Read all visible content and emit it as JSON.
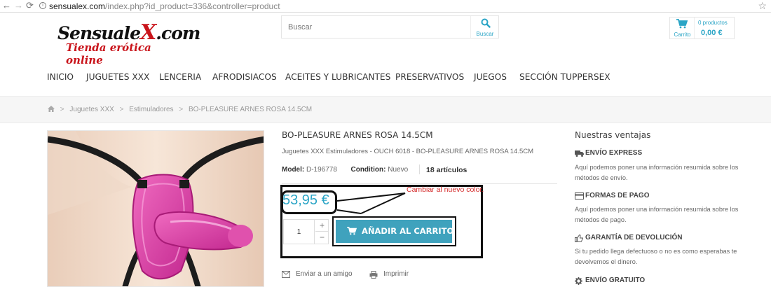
{
  "browser": {
    "url_host": "sensualex.com",
    "url_path": "/index.php?id_product=336&controller=product"
  },
  "header": {
    "logo_main": "Sensuale",
    "logo_x": "X",
    "logo_suffix": ".com",
    "logo_sub": "Tienda erótica online",
    "search_placeholder": "Buscar",
    "search_button": "Buscar",
    "cart_label": "Carrito",
    "cart_count": "0 productos",
    "cart_total": "0,00 €"
  },
  "menu": [
    "INICIO",
    "JUGUETES XXX",
    "LENCERIA",
    "AFRODISIACOS",
    "ACEITES Y LUBRICANTES",
    "PRESERVATIVOS",
    "JUEGOS",
    "SECCIÓN TUPPERSEX"
  ],
  "breadcrumb": {
    "sep": ">",
    "items": [
      "Juguetes XXX",
      "Estimuladores",
      "BO-PLEASURE ARNES ROSA 14.5CM"
    ]
  },
  "product": {
    "title": "BO-PLEASURE ARNES ROSA 14.5CM",
    "categories": "Juguetes XXX Estimuladores - OUCH 6018 - BO-PLEASURE ARNES ROSA 14.5CM",
    "model_label": "Model:",
    "model_value": "D-196778",
    "condition_label": "Condition:",
    "condition_value": "Nuevo",
    "stock": "18 artículos",
    "price": "53,95 €",
    "quantity": "1",
    "qty_up": "+",
    "qty_down": "−",
    "add_to_cart": "AÑADIR AL CARRITO",
    "send_friend": "Enviar a un amigo",
    "print": "Imprimir"
  },
  "annotation": {
    "text": "Cambiar al nuevo color.",
    "color": "#d42a2a"
  },
  "advantages": {
    "title": "Nuestras ventajas",
    "items": [
      {
        "icon": "truck-icon",
        "title": "ENVÍO EXPRESS",
        "text": "Aquí podemos poner una información resumida sobre los métodos de envío."
      },
      {
        "icon": "credit-card-icon",
        "title": "FORMAS DE PAGO",
        "text": "Aquí podemos poner una información resumida sobre los métodos de pago."
      },
      {
        "icon": "thumbs-up-icon",
        "title": "GARANTÍA DE DEVOLUCIÓN",
        "text": "Si tu pedido llega defectuoso o no es como esperabas te devolvemos el dinero."
      },
      {
        "icon": "gear-icon",
        "title": "ENVÍO GRATUITO"
      }
    ]
  },
  "colors": {
    "accent": "#2ba5c6",
    "button": "#3fa2bd",
    "brand_red": "#c9141b"
  }
}
